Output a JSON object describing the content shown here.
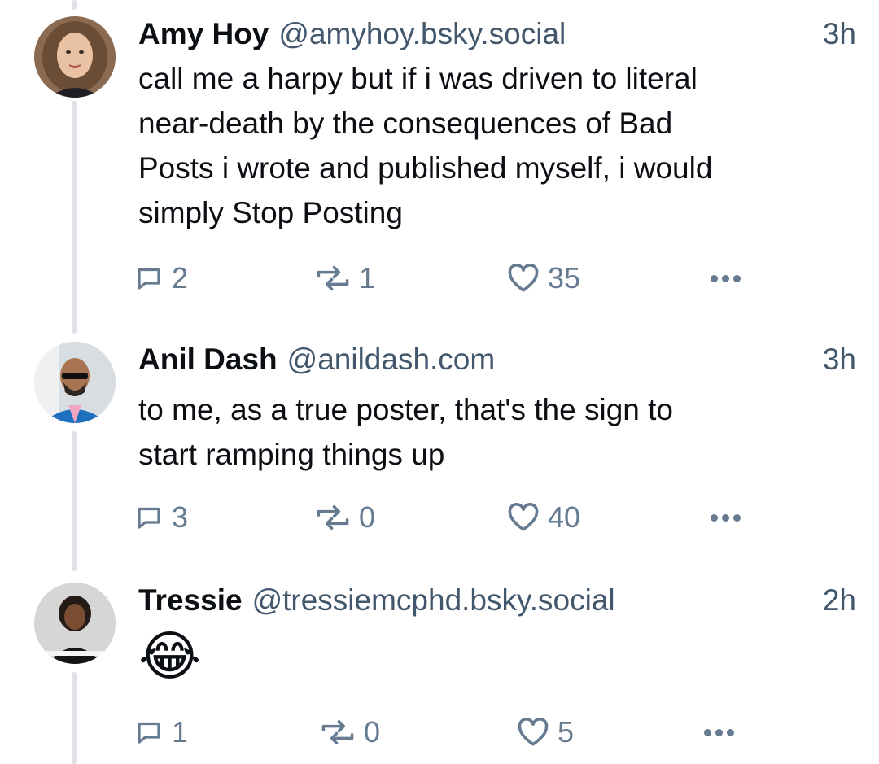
{
  "posts": [
    {
      "author_name": "Amy Hoy",
      "handle": "@amyhoy.bsky.social",
      "time": "3h",
      "text_lines": [
        "call me a harpy but if i was driven to literal",
        "near-death by the consequences of Bad",
        "Posts i wrote and published myself, i would",
        "simply Stop Posting"
      ],
      "replies": "2",
      "reposts": "1",
      "likes": "35"
    },
    {
      "author_name": "Anil Dash",
      "handle": "@anildash.com",
      "time": "3h",
      "text_lines": [
        "to me, as a true poster, that's the sign to",
        "start ramping things up"
      ],
      "replies": "3",
      "reposts": "0",
      "likes": "40"
    },
    {
      "author_name": "Tressie",
      "handle": "@tressiemcphd.bsky.social",
      "time": "2h",
      "text_lines": [
        "😂"
      ],
      "replies": "1",
      "reposts": "0",
      "likes": "5"
    }
  ],
  "icons": {
    "reply": "reply-bubble-icon",
    "repost": "repost-arrows-icon",
    "like": "heart-icon",
    "more": "more-dots-icon"
  },
  "colors": {
    "text": "#0b0f14",
    "secondary": "#42576c",
    "action": "#667b90",
    "thread_line": "#dfe3e8"
  }
}
